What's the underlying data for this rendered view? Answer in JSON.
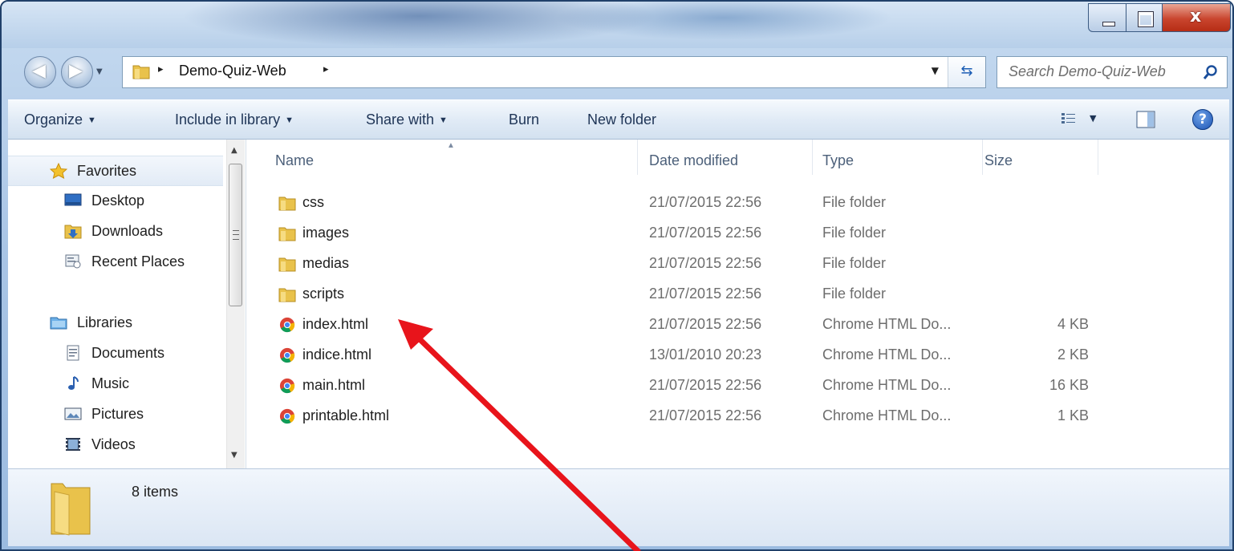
{
  "address": {
    "path": "Demo-Quiz-Web",
    "separator": "▸"
  },
  "search": {
    "placeholder": "Search Demo-Quiz-Web"
  },
  "commandbar": {
    "organize": "Organize",
    "include_in_library": "Include in library",
    "share_with": "Share with",
    "burn": "Burn",
    "new_folder": "New folder"
  },
  "navpane": {
    "favorites": "Favorites",
    "desktop": "Desktop",
    "downloads": "Downloads",
    "recent_places": "Recent Places",
    "libraries": "Libraries",
    "documents": "Documents",
    "music": "Music",
    "pictures": "Pictures",
    "videos": "Videos"
  },
  "columns": {
    "name": "Name",
    "date_modified": "Date modified",
    "type": "Type",
    "size": "Size"
  },
  "files": [
    {
      "name": "css",
      "date": "21/07/2015 22:56",
      "type": "File folder",
      "size": ""
    },
    {
      "name": "images",
      "date": "21/07/2015 22:56",
      "type": "File folder",
      "size": ""
    },
    {
      "name": "medias",
      "date": "21/07/2015 22:56",
      "type": "File folder",
      "size": ""
    },
    {
      "name": "scripts",
      "date": "21/07/2015 22:56",
      "type": "File folder",
      "size": ""
    },
    {
      "name": "index.html",
      "date": "21/07/2015 22:56",
      "type": "Chrome HTML Do...",
      "size": "4 KB"
    },
    {
      "name": "indice.html",
      "date": "13/01/2010 20:23",
      "type": "Chrome HTML Do...",
      "size": "2 KB"
    },
    {
      "name": "main.html",
      "date": "21/07/2015 22:56",
      "type": "Chrome HTML Do...",
      "size": "16 KB"
    },
    {
      "name": "printable.html",
      "date": "21/07/2015 22:56",
      "type": "Chrome HTML Do...",
      "size": "1 KB"
    }
  ],
  "details": {
    "count": "8 items"
  },
  "colors": {
    "annotation_arrow": "#e8141b",
    "folder": "#e9c24b",
    "window_frame": "#9bbbe0"
  }
}
